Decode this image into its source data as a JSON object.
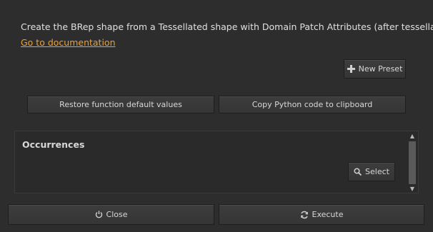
{
  "description": "Create the BRep shape from a Tessellated shape with Domain Patch Attributes (after tessellate)",
  "doc_link": "Go to documentation",
  "buttons": {
    "new_preset": "New Preset",
    "restore_defaults": "Restore function default values",
    "copy_python": "Copy Python code to clipboard",
    "select": "Select",
    "close": "Close",
    "execute": "Execute"
  },
  "occurrences": {
    "title": "Occurrences"
  },
  "icons": {
    "new_preset": "plus-icon",
    "select": "search-icon",
    "close": "power-icon",
    "execute": "refresh-icon",
    "scroll_up": "arrow-up-icon",
    "scroll_down": "arrow-down-icon"
  },
  "colors": {
    "background": "#2d2d2d",
    "link": "#f0a030",
    "button": "#3a3a3a",
    "text": "#d6d6d6"
  }
}
